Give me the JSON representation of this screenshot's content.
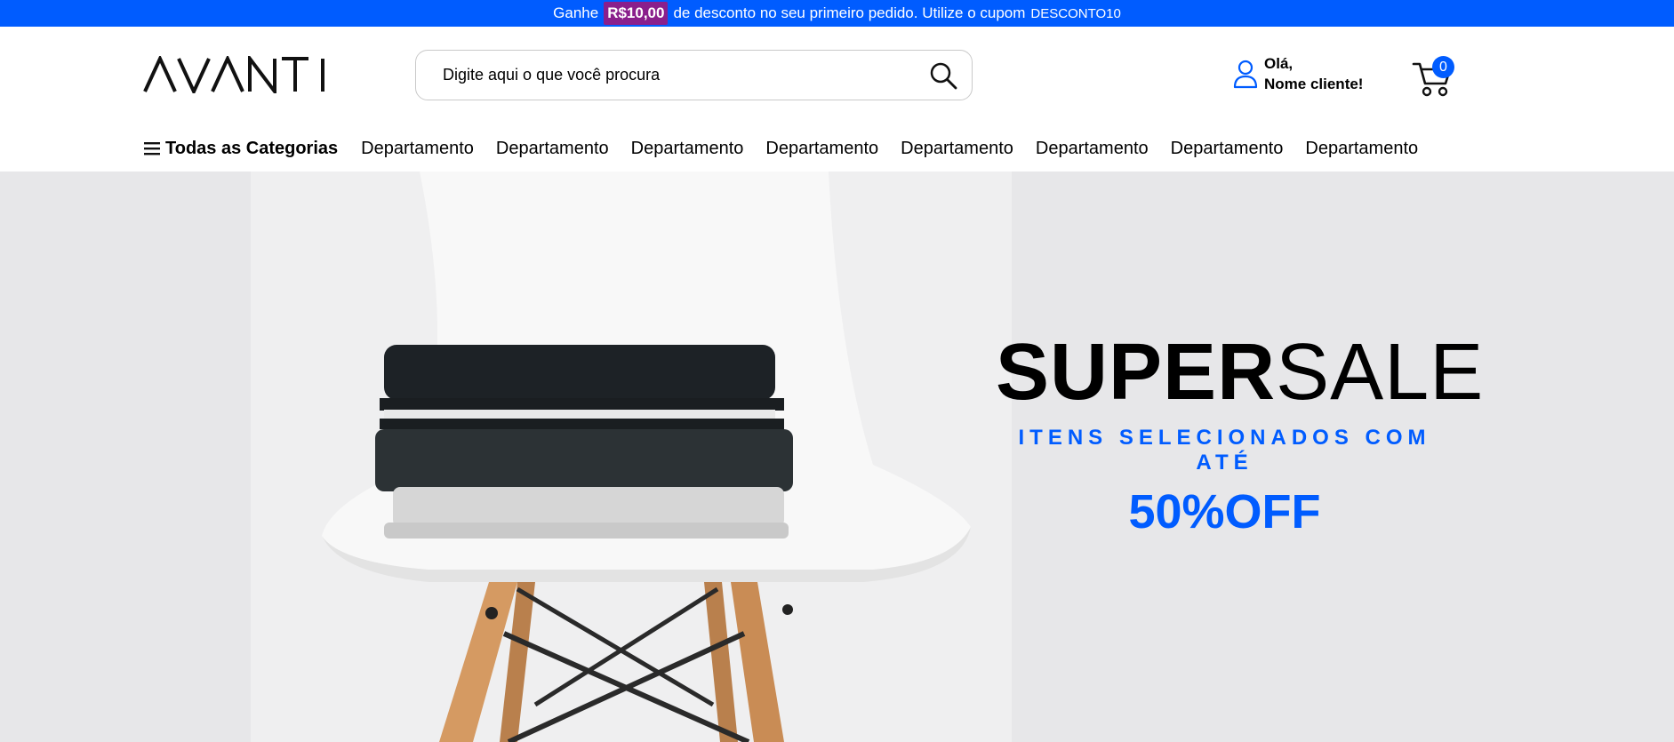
{
  "promo": {
    "prefix": "Ganhe",
    "amount": "R$10,00",
    "text": "de desconto no seu primeiro pedido. Utilize o cupom",
    "coupon": "DESCONTO10"
  },
  "header": {
    "logo": "AVANTI",
    "search": {
      "placeholder": "Digite aqui o que você procura"
    },
    "account": {
      "greeting": "Olá,",
      "name": "Nome cliente!"
    },
    "cart": {
      "count": "0"
    }
  },
  "nav": {
    "all_categories": "Todas as Categorias",
    "departments": [
      "Departamento",
      "Departamento",
      "Departamento",
      "Departamento",
      "Departamento",
      "Departamento",
      "Departamento",
      "Departamento"
    ]
  },
  "banner": {
    "title_bold": "SUPER",
    "title_light": "SALE",
    "subtitle": "ITENS SELECIONADOS COM ATÉ",
    "discount": "50%OFF"
  },
  "colors": {
    "brand_blue": "#005cff",
    "promo_highlight": "#8a1f8c",
    "banner_bg": "#e7e7e9"
  }
}
